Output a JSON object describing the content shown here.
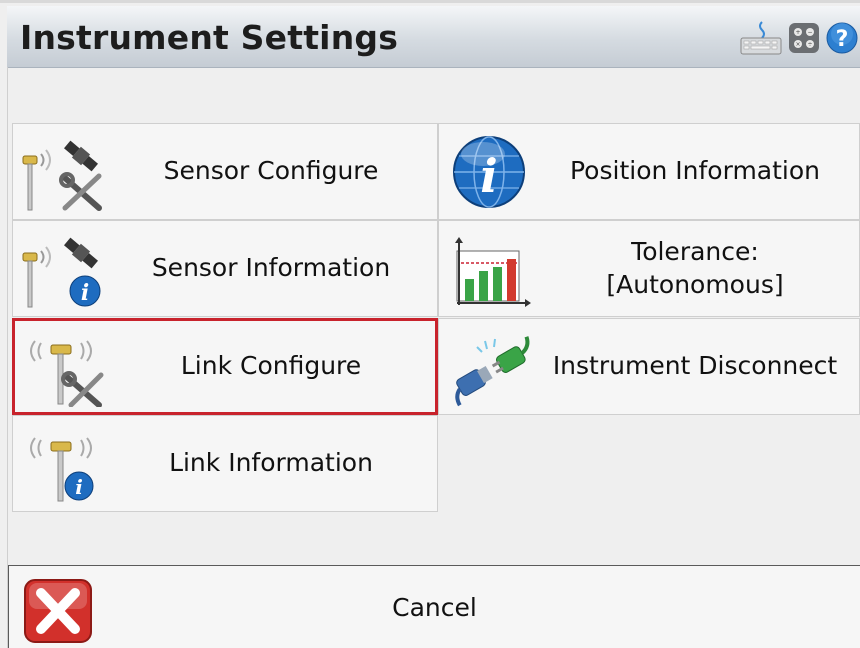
{
  "window": {
    "title": "Instrument Settings"
  },
  "toolbar_icons": [
    "keyboard-icon",
    "calculator-icon",
    "help-icon"
  ],
  "buttons": {
    "sensor_configure": "Sensor Configure",
    "position_information": "Position Information",
    "sensor_information": "Sensor Information",
    "tolerance": "Tolerance:\n[Autonomous]",
    "link_configure": "Link Configure",
    "instrument_disconnect": "Instrument Disconnect",
    "link_information": "Link Information"
  },
  "cancel": {
    "label": "Cancel"
  },
  "colors": {
    "selection_border": "#c8232c",
    "info_blue": "#1d6fc4",
    "cancel_red": "#d2302b"
  }
}
